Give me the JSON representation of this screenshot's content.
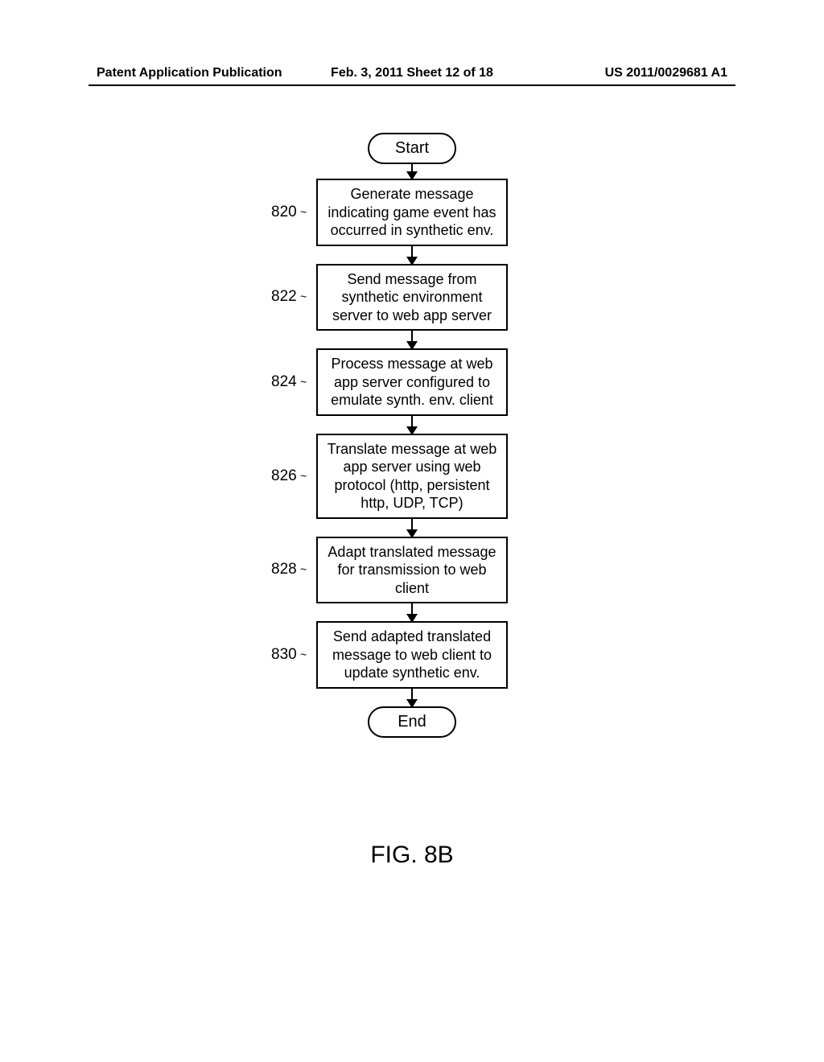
{
  "header": {
    "left": "Patent Application Publication",
    "center": "Feb. 3, 2011   Sheet 12 of 18",
    "right": "US 2011/0029681 A1"
  },
  "flowchart": {
    "start": "Start",
    "end": "End",
    "steps": [
      {
        "ref": "820",
        "text": "Generate message indicating game event has occurred in synthetic env."
      },
      {
        "ref": "822",
        "text": "Send message from synthetic environment server to web app server"
      },
      {
        "ref": "824",
        "text": "Process message at web app server configured to emulate synth. env. client"
      },
      {
        "ref": "826",
        "text": "Translate message at web app server using web protocol (http, persistent http, UDP, TCP)"
      },
      {
        "ref": "828",
        "text": "Adapt translated message for transmission to web client"
      },
      {
        "ref": "830",
        "text": "Send adapted translated message to web client to update synthetic env."
      }
    ]
  },
  "figure_label": "FIG. 8B"
}
